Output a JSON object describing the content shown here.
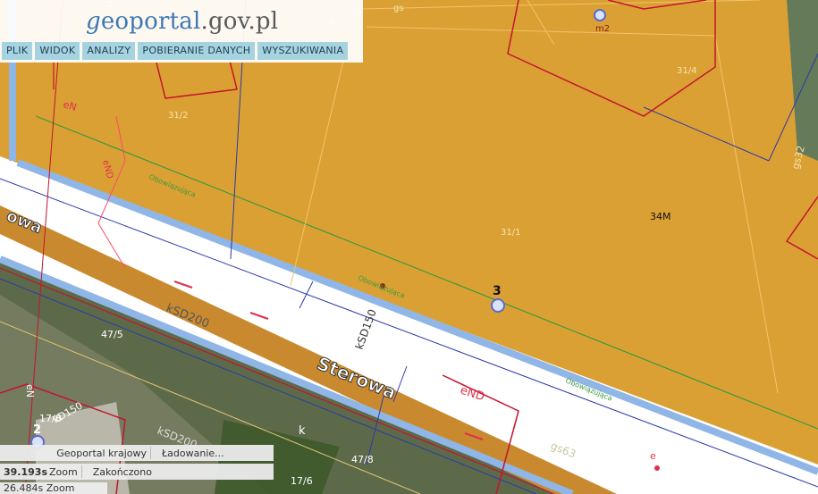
{
  "header": {
    "logo_g": "g",
    "logo_eo": "eo",
    "logo_portal": "portal",
    "logo_domain": ".gov.pl",
    "menu": [
      "PLIK",
      "WIDOK",
      "ANALIZY",
      "POBIERANIE DANYCH",
      "WYSZUKIWANIA"
    ]
  },
  "map": {
    "street_name": "Sterowa",
    "street_name_left": "owa",
    "parcel_labels": [
      "31/1",
      "31/2",
      "31/4",
      "34M",
      "47/8",
      "47/5",
      "17/8",
      "17/6",
      "2",
      "3"
    ],
    "point_labels": [
      "m2",
      "3",
      "2"
    ],
    "utility_labels": [
      "kSD200",
      "kSD150",
      "kSD200",
      "eN",
      "eND",
      "eND",
      "gs63",
      "gs32",
      "kD150",
      "eN"
    ],
    "zone_labels": [
      "Obowiązująca",
      "Obowiązująca",
      "Obowiązująca"
    ],
    "misc_labels": [
      "7",
      "e",
      "k",
      "gs"
    ]
  },
  "status": {
    "app_name": "Geoportal krajowy",
    "loading": "Ładowanie...",
    "time": "39.193s",
    "zoom_label": "Zoom",
    "state": "Zakończono",
    "coords": "26.484s Zoom"
  },
  "colors": {
    "building_zone": "#dba034",
    "road": "#c98a2f",
    "road_edge": "#8fb6e6",
    "parcel_red": "#c3142e",
    "zone_green": "#3c9a3c",
    "utility_blue": "#2b3aa8"
  }
}
